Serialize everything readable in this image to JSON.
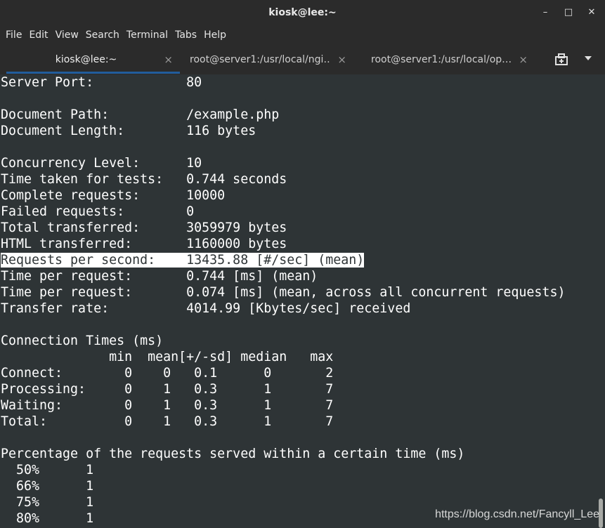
{
  "window": {
    "title": "kiosk@lee:~",
    "minimize": "–",
    "maximize": "□",
    "close": "✕"
  },
  "menu": [
    "File",
    "Edit",
    "View",
    "Search",
    "Terminal",
    "Tabs",
    "Help"
  ],
  "tabs": [
    {
      "label": "kiosk@lee:~",
      "close": "×"
    },
    {
      "label": "root@server1:/usr/local/ngi…",
      "close": "×"
    },
    {
      "label": "root@server1:/usr/local/op…",
      "close": "×"
    }
  ],
  "terminal": {
    "lines": [
      "Server Port:            80",
      "",
      "Document Path:          /example.php",
      "Document Length:        116 bytes",
      "",
      "Concurrency Level:      10",
      "Time taken for tests:   0.744 seconds",
      "Complete requests:      10000",
      "Failed requests:        0",
      "Total transferred:      3059979 bytes",
      "HTML transferred:       1160000 bytes",
      "Requests per second:    13435.88 [#/sec] (mean)",
      "Time per request:       0.744 [ms] (mean)",
      "Time per request:       0.074 [ms] (mean, across all concurrent requests)",
      "Transfer rate:          4014.99 [Kbytes/sec] received",
      "",
      "Connection Times (ms)",
      "              min  mean[+/-sd] median   max",
      "Connect:        0    0   0.1      0       2",
      "Processing:     0    1   0.3      1       7",
      "Waiting:        0    1   0.3      1       7",
      "Total:          0    1   0.3      1       7",
      "",
      "Percentage of the requests served within a certain time (ms)",
      "  50%      1",
      "  66%      1",
      "  75%      1",
      "  80%      1"
    ],
    "highlighted_line_index": 11
  },
  "watermark": "https://blog.csdn.net/Fancyll_Lee",
  "colors": {
    "terminal_bg": "#2e3436",
    "terminal_fg": "#ffffff",
    "chrome_bg": "#2b2b2b",
    "active_tab_underline": "#215d9c"
  }
}
